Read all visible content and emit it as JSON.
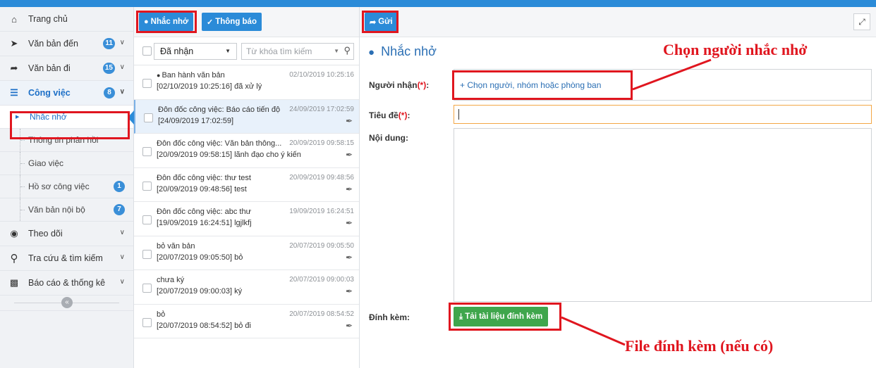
{
  "sidebar": {
    "items": [
      {
        "label": "Trang chủ",
        "icon": "home-icon"
      },
      {
        "label": "Văn bản đến",
        "icon": "arrow-circle-right-icon",
        "badge": "11"
      },
      {
        "label": "Văn bản đi",
        "icon": "arrow-circle-left-icon",
        "badge": "15"
      },
      {
        "label": "Công việc",
        "icon": "tasks-icon",
        "badge": "8"
      }
    ],
    "sub_items": [
      {
        "label": "Nhắc nhở"
      },
      {
        "label": "Thông tin phản hồi"
      },
      {
        "label": "Giao việc"
      },
      {
        "label": "Hồ sơ công việc",
        "badge": "1"
      },
      {
        "label": "Văn bản nội bộ",
        "badge": "7"
      }
    ],
    "bottom_items": [
      {
        "label": "Theo dõi",
        "icon": "eye-icon"
      },
      {
        "label": "Tra cứu & tìm kiếm",
        "icon": "search-icon"
      },
      {
        "label": "Báo cáo & thống kê",
        "icon": "bar-chart-icon"
      }
    ]
  },
  "middle": {
    "tabs": {
      "reminder": "Nhắc nhở",
      "notice": "Thông báo"
    },
    "filter_selected": "Đã nhận",
    "search_placeholder": "Từ khóa tìm kiếm",
    "messages": [
      {
        "title": "Ban hành văn bản",
        "time": "02/10/2019 10:25:16",
        "body": "[02/10/2019 10:25:16] đã xử lý",
        "bubble": true,
        "attachment": false
      },
      {
        "title": "Đôn đốc công việc: Báo cáo tiến độ",
        "time": "24/09/2019 17:02:59",
        "body": "[24/09/2019 17:02:59]",
        "attachment": true
      },
      {
        "title": "Đôn đốc công việc: Văn bản thông...",
        "time": "20/09/2019 09:58:15",
        "body": "[20/09/2019 09:58:15] lãnh đạo cho ý kiến",
        "attachment": true
      },
      {
        "title": "Đôn đốc công việc: thư test",
        "time": "20/09/2019 09:48:56",
        "body": "[20/09/2019 09:48:56] test",
        "attachment": true
      },
      {
        "title": "Đôn đốc công việc: abc thư",
        "time": "19/09/2019 16:24:51",
        "body": "[19/09/2019 16:24:51] lgjlkfj",
        "attachment": true
      },
      {
        "title": "bỏ văn bản",
        "time": "20/07/2019 09:05:50",
        "body": "[20/07/2019 09:05:50] bỏ",
        "attachment": true
      },
      {
        "title": "chưa ký",
        "time": "20/07/2019 09:00:03",
        "body": "[20/07/2019 09:00:03] ký",
        "attachment": true
      },
      {
        "title": "bỏ",
        "time": "20/07/2019 08:54:52",
        "body": "[20/07/2019 08:54:52] bỏ đi",
        "attachment": true
      }
    ]
  },
  "form": {
    "send_label": "Gửi",
    "title": "Nhắc nhở",
    "recipient_label": "Người nhận",
    "recipient_req": "(*)",
    "recipient_colon": ":",
    "recipient_link": "+ Chọn người, nhóm hoặc phòng ban",
    "subject_label": "Tiêu đề",
    "subject_req": "(*)",
    "subject_colon": ":",
    "content_label": "Nội dung:",
    "attach_label": "Đính kèm:",
    "upload_label": "Tải tài liệu đính kèm"
  },
  "annotations": {
    "choose_person": "Chọn người nhắc nhở",
    "attach_file": "File đính kèm (nếu có)"
  },
  "colors": {
    "accent": "#2b8bd8",
    "highlight": "#e0161f",
    "upload": "#3fa64c"
  }
}
